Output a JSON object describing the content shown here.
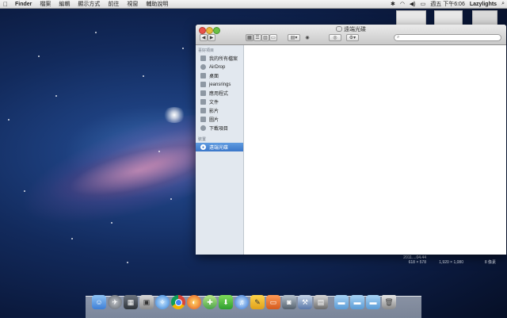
{
  "menubar": {
    "app_name": "Finder",
    "menus": [
      "檔案",
      "編輯",
      "顯示方式",
      "前往",
      "視窗",
      "輔助說明"
    ],
    "clock": "週五 下午6:06",
    "user": "Lazylights"
  },
  "window": {
    "title": "遠端光碟",
    "search_placeholder": ""
  },
  "sidebar": {
    "favorites_header": "喜好項目",
    "items": [
      {
        "label": "我的所有檔案",
        "icon": "all-files-icon"
      },
      {
        "label": "AirDrop",
        "icon": "airdrop-icon"
      },
      {
        "label": "桌面",
        "icon": "desktop-icon"
      },
      {
        "label": "jeansrings",
        "icon": "home-icon"
      },
      {
        "label": "應用程式",
        "icon": "applications-icon"
      },
      {
        "label": "文件",
        "icon": "documents-icon"
      },
      {
        "label": "影片",
        "icon": "movies-icon"
      },
      {
        "label": "圖片",
        "icon": "pictures-icon"
      },
      {
        "label": "下載項目",
        "icon": "downloads-icon"
      }
    ],
    "devices_header": "裝置",
    "devices": [
      {
        "label": "遠端光碟",
        "icon": "remote-disc-icon",
        "selected": true
      }
    ]
  },
  "desktop_info": {
    "file_a": "2011....04.44",
    "file_a_dims": "618 × 578",
    "file_b_dims": "1,920 × 1,080",
    "file_c_size": "8 像素"
  },
  "dock": {
    "icons": [
      "finder-icon",
      "launchpad-icon",
      "mission-control-icon",
      "preview-icon",
      "safari-icon",
      "chrome-icon",
      "firefox-icon",
      "cyberduck-icon",
      "torrent-icon",
      "itunes-icon",
      "stickies-icon",
      "keynote-icon",
      "facetime-icon",
      "xcode-icon",
      "photo-booth-icon",
      "folder-icon",
      "downloads-folder-icon",
      "documents-folder-icon",
      "trash-icon"
    ]
  }
}
